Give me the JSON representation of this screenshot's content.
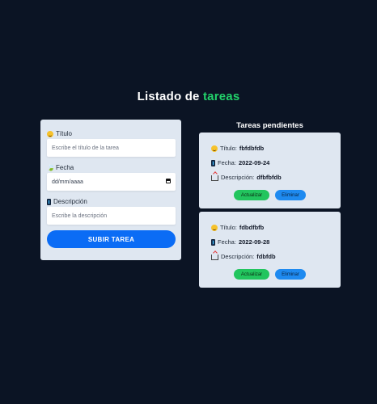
{
  "page": {
    "title_prefix": "Listado de",
    "title_accent": "tareas"
  },
  "form": {
    "title_label": "Título",
    "title_placeholder": "Escribe el título de la tarea",
    "date_label": "Fecha",
    "date_placeholder": "dd/mm/aaaa",
    "description_label": "Descripción",
    "description_placeholder": "Escribe la descripción",
    "submit_label": "SUBIR TAREA"
  },
  "tasks": {
    "heading": "Tareas pendientes",
    "title_prefix": "Título:",
    "date_prefix": "Fecha:",
    "description_prefix": "Descripción:",
    "update_label": "Actualizar",
    "delete_label": "Eliminar",
    "items": [
      {
        "title": "fbfdbfdb",
        "date": "2022-09-24",
        "description": "dfbfbfdb"
      },
      {
        "title": "fdbdfbfb",
        "date": "2022-09-28",
        "description": "fdbfdb"
      }
    ]
  },
  "colors": {
    "background": "#0b1424",
    "accent_green": "#22d36b",
    "primary_blue": "#0b6cf5",
    "card": "#dfe7f1",
    "update_button": "#22c55e",
    "delete_button": "#1e8af0"
  },
  "icons": {
    "title": "smiley-icon",
    "date": "calendar-icon",
    "description": "phone-icon",
    "task_description": "outbox-icon"
  }
}
